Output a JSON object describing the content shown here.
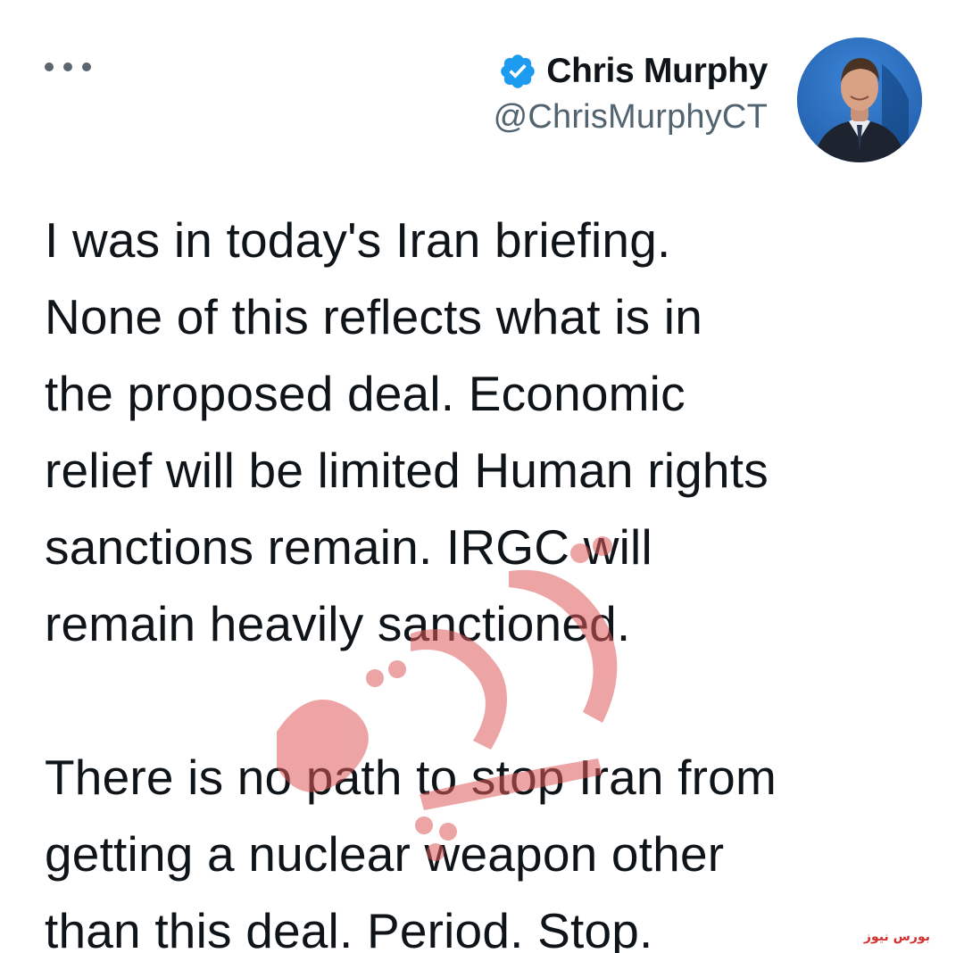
{
  "tweet": {
    "author": {
      "display_name": "Chris Murphy",
      "handle": "@ChrisMurphyCT",
      "verified": true,
      "verified_icon": "verified-badge-icon",
      "avatar": "avatar-photo"
    },
    "menu_icon": "more-options-icon",
    "paragraphs": [
      "I was in today's Iran briefing.\nNone of this reflects what is in\nthe proposed deal. Economic\nrelief will be limited Human rights\nsanctions remain. IRGC will\nremain heavily sanctioned.",
      "There is no path to stop Iran from\ngetting a nuclear weapon other\nthan this deal. Period. Stop."
    ]
  },
  "watermark": {
    "text": "بورس نیوز",
    "color": "#e05a5a"
  },
  "corner_watermark": {
    "text": "بورس نیوز",
    "color": "#d32f2f"
  },
  "colors": {
    "text_primary": "#0f1419",
    "text_secondary": "#536471",
    "verified_blue": "#1d9bf0"
  }
}
